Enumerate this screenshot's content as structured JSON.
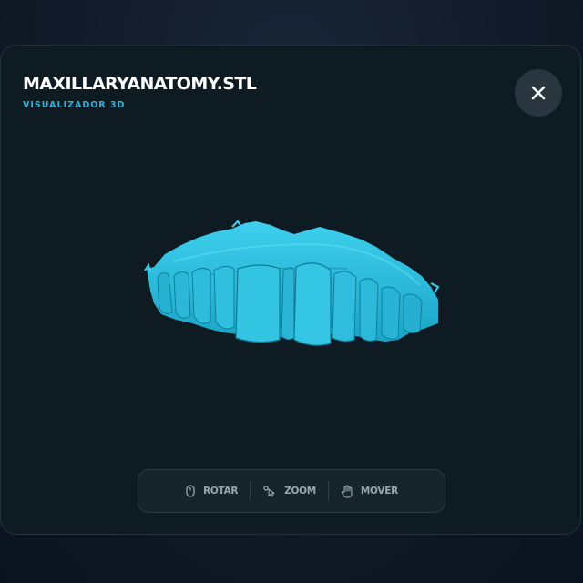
{
  "header": {
    "title": "MAXILLARYANATOMY.STL",
    "subtitle": "VISUALIZADOR 3D"
  },
  "close_icon": "close-icon",
  "model": {
    "name": "maxillary-dental-scan",
    "color": "#2ab8d8"
  },
  "controls": [
    {
      "label": "ROTAR",
      "icon": "mouse-icon"
    },
    {
      "label": "ZOOM",
      "icon": "zoom-pointer-icon"
    },
    {
      "label": "MOVER",
      "icon": "hand-icon"
    }
  ],
  "colors": {
    "accent": "#2bb3d8",
    "panel": "#0f1b22",
    "toolbar": "#17242c"
  }
}
